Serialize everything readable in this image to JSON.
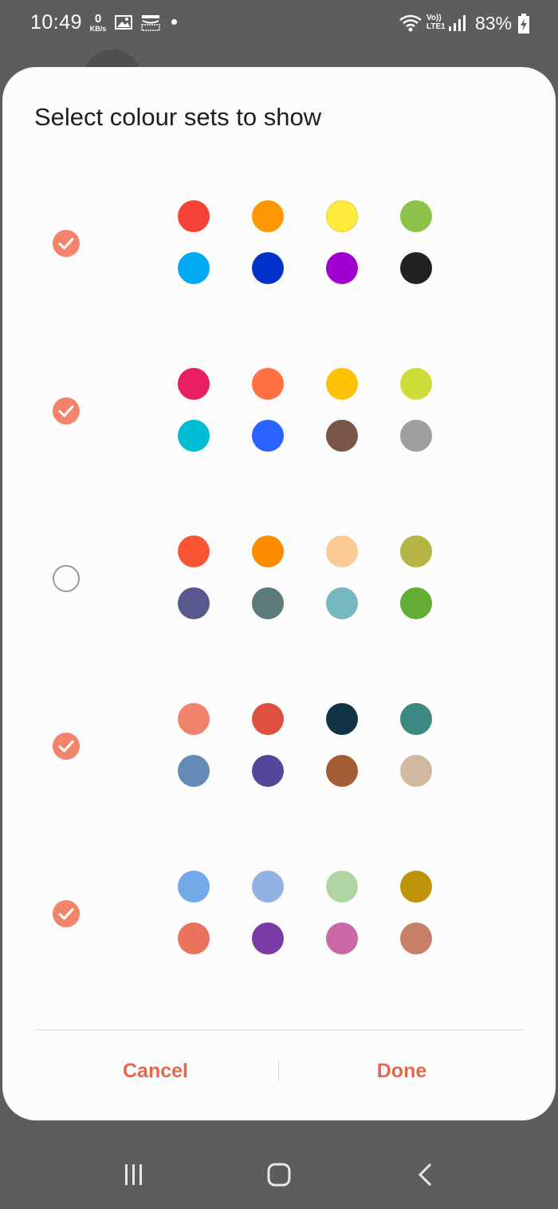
{
  "status_bar": {
    "time": "10:49",
    "net_speed_value": "0",
    "net_speed_unit": "KB/s",
    "volte_line1": "Vo))",
    "volte_line2": "LTE1",
    "battery_percent": "83%",
    "icons": [
      "gallery-icon",
      "amazon-icon",
      "notification-dot-icon",
      "wifi-icon",
      "signal-icon",
      "battery-charging-icon"
    ]
  },
  "dialog": {
    "title": "Select colour sets to show",
    "colour_sets": [
      {
        "checked": true,
        "colors": [
          "#f44336",
          "#ff9800",
          "#ffeb3b",
          "#8bc34a",
          "#03a9f4",
          "#0033cc",
          "#a000d0",
          "#222222"
        ]
      },
      {
        "checked": true,
        "colors": [
          "#e91e63",
          "#ff7043",
          "#ffc107",
          "#cddc39",
          "#00bcd4",
          "#2962ff",
          "#795548",
          "#9e9e9e"
        ]
      },
      {
        "checked": false,
        "colors": [
          "#fa5533",
          "#fb8c00",
          "#fccb94",
          "#b5b546",
          "#58588f",
          "#5b7a7a",
          "#76b8bf",
          "#62ae34"
        ]
      },
      {
        "checked": true,
        "colors": [
          "#f1836d",
          "#dd5040",
          "#123344",
          "#3d8981",
          "#648bb5",
          "#53479a",
          "#a25d33",
          "#d1b8a0"
        ]
      },
      {
        "checked": true,
        "colors": [
          "#72aae9",
          "#93b1e3",
          "#b0d5a4",
          "#bf9307",
          "#eb725d",
          "#7b3ba4",
          "#ca67a7",
          "#c78067"
        ]
      }
    ],
    "cancel_label": "Cancel",
    "done_label": "Done",
    "accent_color": "#e7674b",
    "checkbox_color": "#f4836b"
  },
  "nav_bar": {
    "icons": [
      "recents-icon",
      "home-icon",
      "back-icon"
    ]
  }
}
